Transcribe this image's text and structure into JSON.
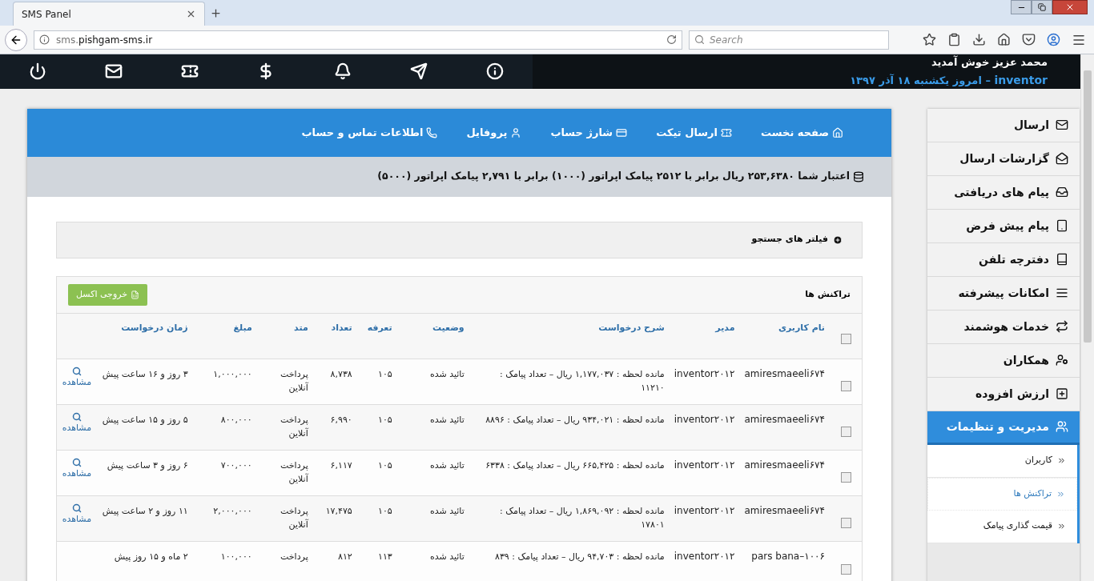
{
  "browser": {
    "tab_title": "SMS Panel",
    "url_host": "sms.",
    "url_domain": "pishgam-sms.ir",
    "search_placeholder": "Search"
  },
  "header": {
    "welcome": "محمد عزیز خوش آمدید",
    "username": "inventor",
    "date": "– امروز یکشنبه ۱۸ آذر ۱۳۹۷"
  },
  "top_nav": [
    {
      "label": "صفحه نخست"
    },
    {
      "label": "ارسال تیکت"
    },
    {
      "label": "شارژ حساب"
    },
    {
      "label": "پروفایل"
    },
    {
      "label": "اطلاعات تماس و حساب"
    }
  ],
  "credit": "اعتبار شما ۲۵۳,۶۳۸۰ ریال برابر با ۲۵۱۲ پیامک اپراتور (۱۰۰۰) برابر با ۲,۷۹۱ پیامک اپراتور (۵۰۰۰)",
  "filter": {
    "label": "فیلتر های جستجو",
    "expanded": false
  },
  "transactions": {
    "title": "تراکنش ها",
    "export_button": "خروجی اکسل",
    "header_checked": false,
    "columns": [
      "نام کاربری",
      "مدیر",
      "شرح درخواست",
      "وضعیت",
      "تعرفه",
      "تعداد",
      "متد",
      "مبلغ",
      "زمان درخواست"
    ],
    "rows": [
      {
        "checked": false,
        "cells": [
          "amiresmaeeli۶۷۴",
          "inventor۲۰۱۲",
          "مانده لحظه : ۱,۱۷۷,۰۳۷ ریال – تعداد پیامک : ۱۱۲۱۰",
          "تائید شده",
          "۱۰۵",
          "۸,۷۳۸",
          "پرداخت آنلاین",
          "۱,۰۰۰,۰۰۰",
          "۳ روز و ۱۶ ساعت پیش"
        ],
        "action": "مشاهده"
      },
      {
        "checked": false,
        "cells": [
          "amiresmaeeli۶۷۴",
          "inventor۲۰۱۲",
          "مانده لحظه : ۹۳۴,۰۲۱ ریال – تعداد پیامک : ۸۸۹۶",
          "تائید شده",
          "۱۰۵",
          "۶,۹۹۰",
          "پرداخت آنلاین",
          "۸۰۰,۰۰۰",
          "۵ روز و ۱۵ ساعت پیش"
        ],
        "action": "مشاهده"
      },
      {
        "checked": false,
        "cells": [
          "amiresmaeeli۶۷۴",
          "inventor۲۰۱۲",
          "مانده لحظه : ۶۶۵,۴۲۵ ریال – تعداد پیامک : ۶۳۳۸",
          "تائید شده",
          "۱۰۵",
          "۶,۱۱۷",
          "پرداخت آنلاین",
          "۷۰۰,۰۰۰",
          "۶ روز و ۳ ساعت پیش"
        ],
        "action": "مشاهده"
      },
      {
        "checked": false,
        "cells": [
          "amiresmaeeli۶۷۴",
          "inventor۲۰۱۲",
          "مانده لحظه : ۱,۸۶۹,۰۹۲ ریال – تعداد پیامک : ۱۷۸۰۱",
          "تائید شده",
          "۱۰۵",
          "۱۷,۴۷۵",
          "پرداخت آنلاین",
          "۲,۰۰۰,۰۰۰",
          "۱۱ روز و ۲ ساعت پیش"
        ],
        "action": "مشاهده"
      },
      {
        "checked": false,
        "cells": [
          "pars bana–۱۰۰۶",
          "inventor۲۰۱۲",
          "مانده لحظه : ۹۴,۷۰۳ ریال – تعداد پیامک : ۸۳۹",
          "تائید شده",
          "۱۱۳",
          "۸۱۲",
          "پرداخت",
          "۱۰۰,۰۰۰",
          "۲ ماه و ۱۵ روز پیش"
        ]
      }
    ]
  },
  "sidebar": [
    {
      "label": "ارسال",
      "selected": false
    },
    {
      "label": "گزارشات ارسال",
      "selected": false
    },
    {
      "label": "پیام های دریافتی",
      "selected": false
    },
    {
      "label": "پیام پیش فرض",
      "selected": false
    },
    {
      "label": "دفترچه تلفن",
      "selected": false
    },
    {
      "label": "امکانات پیشرفته",
      "selected": false
    },
    {
      "label": "خدمات هوشمند",
      "selected": false
    },
    {
      "label": "همکاران",
      "selected": false
    },
    {
      "label": "ارزش افزوده",
      "selected": false
    },
    {
      "label": "مدیریت و تنظیمات",
      "selected": true,
      "expanded": true,
      "children": [
        {
          "label": "کاربران",
          "selected": false
        },
        {
          "label": "تراکنش ها",
          "selected": true
        },
        {
          "label": "قیمت گذاری پیامک",
          "selected": false
        }
      ]
    }
  ]
}
